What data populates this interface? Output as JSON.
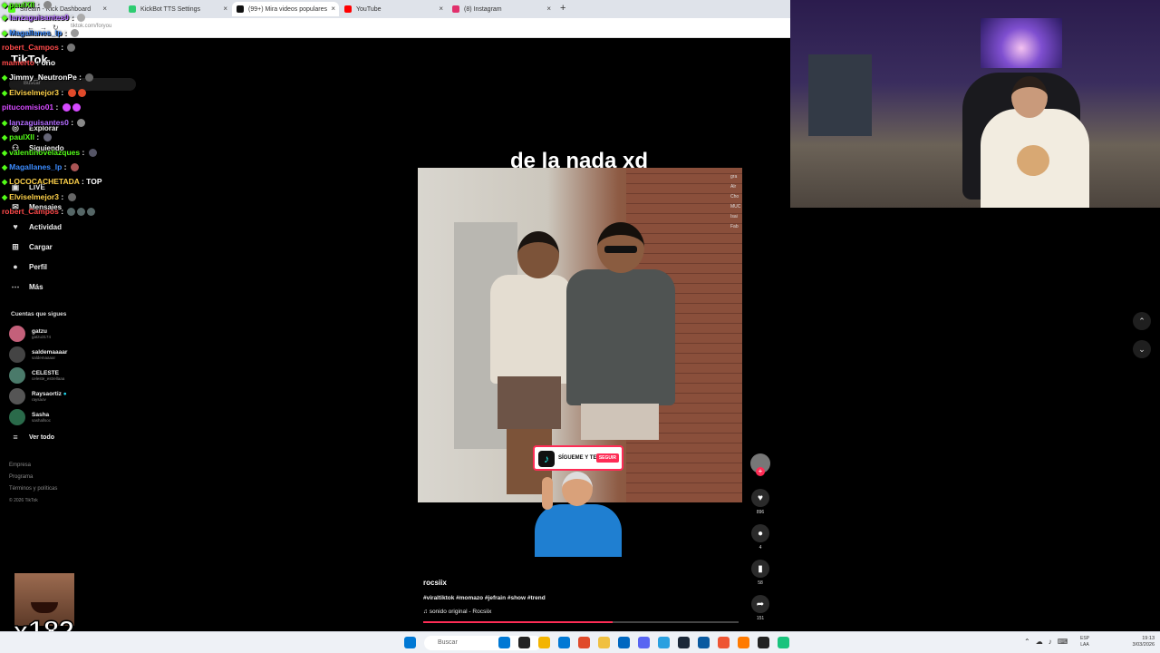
{
  "browser": {
    "tabs": [
      {
        "label": "Stream - Kick Dashboard",
        "color": "#53fc18"
      },
      {
        "label": "KickBot TTS Settings",
        "color": "#2ecc71"
      },
      {
        "label": "(99+) Mira videos populares",
        "color": "#111111"
      },
      {
        "label": "YouTube",
        "color": "#ff0000"
      },
      {
        "label": "(8) Instagram",
        "color": "#e1306c"
      }
    ],
    "url": "tiktok.com/foryou",
    "new_tab": "+"
  },
  "tiktok": {
    "logo": "TikTok",
    "search_placeholder": "Buscar",
    "nav": [
      {
        "label": "Explorar",
        "icon": "compass-icon",
        "glyph": "◎"
      },
      {
        "label": "Siguiendo",
        "icon": "following-icon",
        "glyph": "⚇"
      },
      {
        "label": "LIVE",
        "icon": "live-icon",
        "glyph": "▣"
      },
      {
        "label": "Mensajes",
        "icon": "messages-icon",
        "glyph": "✉"
      },
      {
        "label": "Actividad",
        "icon": "activity-icon",
        "glyph": "♥"
      },
      {
        "label": "Cargar",
        "icon": "upload-icon",
        "glyph": "⊞"
      },
      {
        "label": "Perfil",
        "icon": "profile-icon",
        "glyph": "●"
      },
      {
        "label": "Más",
        "icon": "more-icon",
        "glyph": "⋯"
      }
    ],
    "accounts_title": "Cuentas que sigues",
    "accounts": [
      {
        "name": "gatzu",
        "handle": "gatzu3174",
        "color": "#c4607a"
      },
      {
        "name": "saldemaaaar",
        "handle": "saldemaaaar",
        "color": "#444444"
      },
      {
        "name": "CELESTE",
        "handle": "celeste_estrellaaa",
        "color": "#4a7a6a"
      },
      {
        "name": "Raysaortiz",
        "handle": "raysaov",
        "color": "#555555"
      },
      {
        "name": "Sasha",
        "handle": "sashallsoc",
        "color": "#2a6a4a"
      }
    ],
    "see_all": "Ver todo",
    "footer": [
      "Empresa",
      "Programa",
      "Términos y políticas",
      "© 2026 TikTok"
    ],
    "video": {
      "caption_overlay": "de la nada xd",
      "sticker_text": "SÍGUEME Y TE SIGO",
      "sticker_button": "SEGUIR",
      "edge_text": [
        "gra",
        "Alr",
        "",
        "Cho",
        "MUC",
        "Isai",
        "Fab"
      ],
      "author": "rocsiix",
      "hashtags": "#viraltiktok #momazo #jefrain #show #trend",
      "sound": "sonido original - Rocsiix",
      "sound_icon": "♫",
      "progress": 0.6
    },
    "actions": [
      {
        "name": "like",
        "glyph": "♥",
        "count": "896"
      },
      {
        "name": "comment",
        "glyph": "●",
        "count": "4"
      },
      {
        "name": "save",
        "glyph": "▮",
        "count": "58"
      },
      {
        "name": "share",
        "glyph": "➦",
        "count": "151"
      }
    ],
    "arrows": {
      "up": "⌃",
      "down": "⌄"
    }
  },
  "chat": [
    {
      "user": "paulXII",
      "color": "#53fc18",
      "msg": "",
      "emotes": [
        "#888"
      ],
      "badge": true
    },
    {
      "user": "lanzaguisantes0",
      "color": "#b36bff",
      "msg": "",
      "emotes": [
        "#aaa"
      ],
      "badge": true
    },
    {
      "user": "Magallanes_lp",
      "color": "#3c8cff",
      "msg": "",
      "emotes": [
        "#999"
      ],
      "badge": true
    },
    {
      "user": "robert_Campos",
      "color": "#ff4a4a",
      "msg": "",
      "emotes": [
        "#777"
      ],
      "badge": false
    },
    {
      "user": "mamerto",
      "color": "#ff4a4a",
      "msg": "oño",
      "emotes": [],
      "badge": false
    },
    {
      "user": "Jimmy_NeutronPe",
      "color": "#ffffff",
      "msg": "",
      "emotes": [
        "#666"
      ],
      "badge": true
    },
    {
      "user": "Elviselmejor3",
      "color": "#ffd24a",
      "msg": "",
      "emotes": [
        "#e04a2a",
        "#e04a2a"
      ],
      "badge": true
    },
    {
      "user": "pitucomisio01",
      "color": "#d64aff",
      "msg": "",
      "emotes": [
        "#d64aff",
        "#d64aff"
      ],
      "badge": false
    },
    {
      "user": "lanzaguisantes0",
      "color": "#b36bff",
      "msg": "",
      "emotes": [
        "#888"
      ],
      "badge": true
    },
    {
      "user": "paulXII",
      "color": "#53fc18",
      "msg": "",
      "emotes": [
        "#667"
      ],
      "badge": true
    },
    {
      "user": "valentinovelazques",
      "color": "#53fc18",
      "msg": "",
      "emotes": [
        "#556"
      ],
      "badge": true
    },
    {
      "user": "Magallanes_lp",
      "color": "#3c8cff",
      "msg": "",
      "emotes": [
        "#a55"
      ],
      "badge": true
    },
    {
      "user": "LOCOCACHETADA",
      "color": "#ffd24a",
      "msg": "TOP",
      "emotes": [],
      "badge": true
    },
    {
      "user": "Elviselmejor3",
      "color": "#ffd24a",
      "msg": "",
      "emotes": [
        "#666"
      ],
      "badge": true
    },
    {
      "user": "robert_Campos",
      "color": "#ff4a4a",
      "msg": "",
      "emotes": [
        "#566",
        "#566",
        "#566"
      ],
      "badge": false
    }
  ],
  "overlay": {
    "multiplier": "x182"
  },
  "taskbar": {
    "search": "Buscar",
    "tray_lang": [
      "ESP",
      "LAA"
    ],
    "clock": [
      "19:13",
      "3/03/2026"
    ],
    "icon_colors": [
      "#0078d4",
      "#222",
      "#f3b400",
      "#0078d4",
      "#e04a2a",
      "#f0c040",
      "#0067c0",
      "#5865f2",
      "#2aa0e0",
      "#1b2838",
      "#0a5aa0",
      "#e53",
      "#ff7a00",
      "#222",
      "#19c37d"
    ]
  }
}
